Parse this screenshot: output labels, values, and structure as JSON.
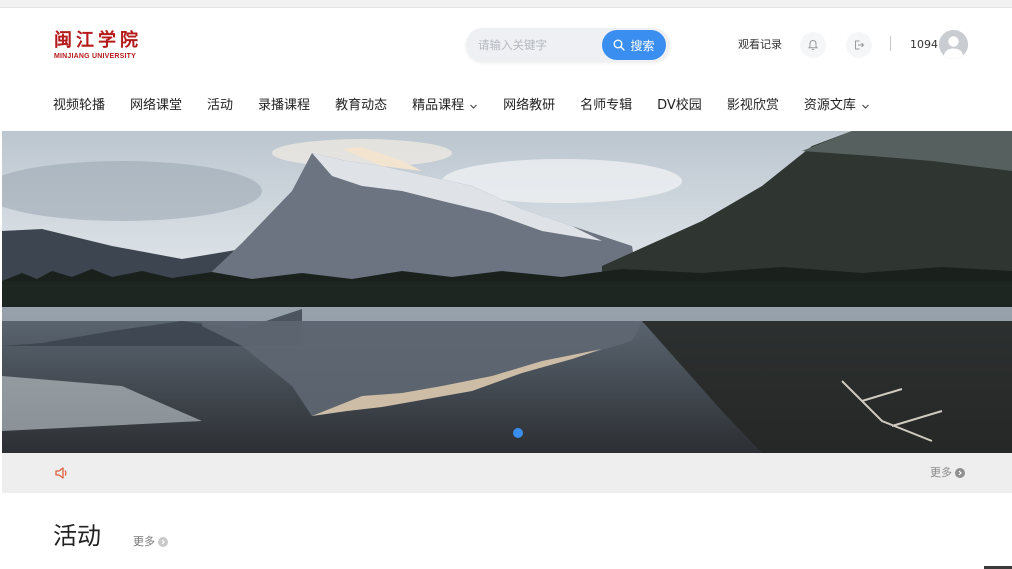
{
  "header": {
    "logo_cn": "闽江学院",
    "logo_en": "MINJIANG UNIVERSITY",
    "search_placeholder": "请输入关键字",
    "search_button": "搜索",
    "history_link": "观看记录",
    "user_id": "1094"
  },
  "nav": {
    "items": [
      {
        "label": "视频轮播",
        "has_dropdown": false
      },
      {
        "label": "网络课堂",
        "has_dropdown": false
      },
      {
        "label": "活动",
        "has_dropdown": false
      },
      {
        "label": "录播课程",
        "has_dropdown": false
      },
      {
        "label": "教育动态",
        "has_dropdown": false
      },
      {
        "label": "精品课程",
        "has_dropdown": true
      },
      {
        "label": "网络教研",
        "has_dropdown": false
      },
      {
        "label": "名师专辑",
        "has_dropdown": false
      },
      {
        "label": "DV校园",
        "has_dropdown": false
      },
      {
        "label": "影视欣赏",
        "has_dropdown": false
      },
      {
        "label": "资源文库",
        "has_dropdown": true
      }
    ]
  },
  "banner": {
    "slide_count": 1,
    "active_slide": 1
  },
  "notice": {
    "more_label": "更多"
  },
  "section": {
    "title": "活动",
    "more_label": "更多"
  },
  "colors": {
    "brand_red": "#b51b1b",
    "accent_blue": "#3a8ef0",
    "notice_bg": "#eeeeee"
  },
  "icons": [
    "search-icon",
    "bell-icon",
    "logout-icon",
    "avatar-icon",
    "chevron-down-icon",
    "speaker-icon",
    "arrow-right-icon"
  ]
}
